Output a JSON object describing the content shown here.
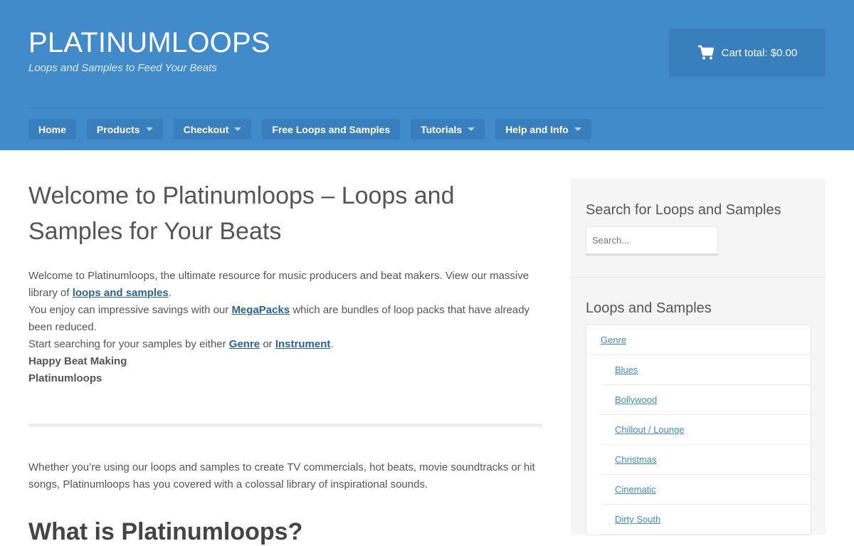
{
  "header": {
    "site_title": "PLATINUMLOOPS",
    "tagline": "Loops and Samples to Feed Your Beats",
    "cart_label": "Cart total: $0.00"
  },
  "nav": {
    "home": "Home",
    "products": "Products",
    "checkout": "Checkout",
    "free": "Free Loops and Samples",
    "tutorials": "Tutorials",
    "help": "Help and Info"
  },
  "main": {
    "title": "Welcome to Platinumloops – Loops and Samples for Your Beats",
    "p1_a": "Welcome to Platinumloops, the ultimate resource for music producers and beat makers. View our massive library of ",
    "p1_link": "loops and samples",
    "p1_b": ".",
    "p2_a": "You enjoy can impressive savings with our ",
    "p2_link": "MegaPacks",
    "p2_b": " which are bundles of loop packs that have already been reduced.",
    "p3_a": "Start searching for your samples by either ",
    "p3_link1": "Genre",
    "p3_mid": " or ",
    "p3_link2": "Instrument",
    "p3_b": ".",
    "happy": "Happy Beat Making",
    "sign": "Platinumloops",
    "para2": "Whether you’re using our loops and samples to create TV commercials, hot beats, movie soundtracks or hit songs, Platinumloops has you covered with a colossal library of inspirational sounds.",
    "h2": "What is Platinumloops?"
  },
  "sidebar": {
    "search_title": "Search for Loops and Samples",
    "search_placeholder": "Search...",
    "loops_title": "Loops and Samples",
    "genre": "Genre",
    "items": [
      "Blues",
      "Bollywood",
      "Chillout / Lounge",
      "Christmas",
      "Cinematic",
      "Dirty South"
    ]
  },
  "colors": {
    "header_bg": "#428bca",
    "nav_item_bg": "#3a7fbd",
    "link": "#2a6496"
  },
  "icons": {
    "cart": "shopping-cart-icon",
    "dropdown": "caret-down-icon"
  }
}
